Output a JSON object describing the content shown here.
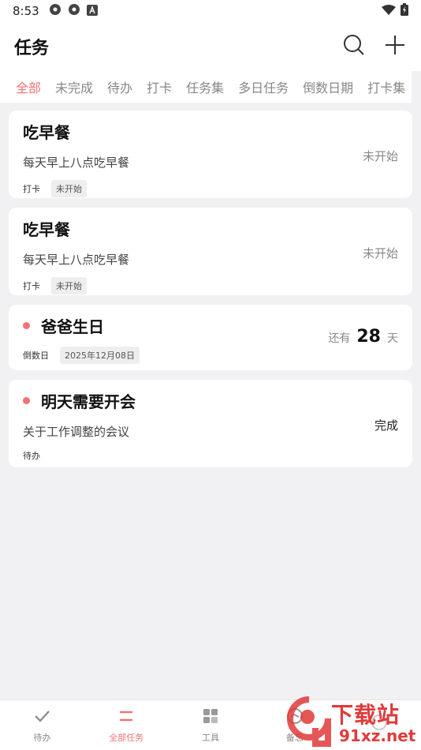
{
  "status_bar": {
    "time": "8:53",
    "left_icons": [
      "settings-gear-icon",
      "settings-gear-icon",
      "a-app-icon"
    ],
    "right_icons": [
      "wifi-icon",
      "battery-icon"
    ]
  },
  "header": {
    "title": "任务",
    "actions": [
      "search-icon",
      "plus-icon"
    ]
  },
  "tabs": [
    {
      "label": "全部",
      "active": true
    },
    {
      "label": "未完成",
      "active": false
    },
    {
      "label": "待办",
      "active": false
    },
    {
      "label": "打卡",
      "active": false
    },
    {
      "label": "任务集",
      "active": false
    },
    {
      "label": "多日任务",
      "active": false
    },
    {
      "label": "倒数日期",
      "active": false
    },
    {
      "label": "打卡集",
      "active": false
    }
  ],
  "tasks": [
    {
      "title": "吃早餐",
      "description": "每天早上八点吃早餐",
      "status": "未开始",
      "type": "打卡",
      "badge": "未开始"
    },
    {
      "title": "吃早餐",
      "description": "每天早上八点吃早餐",
      "status": "未开始",
      "type": "打卡",
      "badge": "未开始"
    },
    {
      "title": "爸爸生日",
      "type": "倒数日",
      "date": "2025年12月08日",
      "countdown_prefix": "还有",
      "countdown_value": "28",
      "countdown_unit": "天"
    },
    {
      "title": "明天需要开会",
      "description": "关于工作调整的会议",
      "status": "完成",
      "type": "待办"
    }
  ],
  "bottom_nav": [
    {
      "label": "待办",
      "icon": "check-icon",
      "active": false
    },
    {
      "label": "全部任务",
      "icon": "menu-lines-icon",
      "active": true
    },
    {
      "label": "工具",
      "icon": "grid-icon",
      "active": false
    },
    {
      "label": "备忘",
      "icon": "memo-icon",
      "active": false
    },
    {
      "label": "",
      "icon": "more-icon",
      "active": false
    }
  ],
  "watermark": {
    "text": "下载站",
    "url": "91xz.net"
  },
  "colors": {
    "accent": "#f07275",
    "background": "#f1f1f3",
    "card": "#ffffff"
  }
}
